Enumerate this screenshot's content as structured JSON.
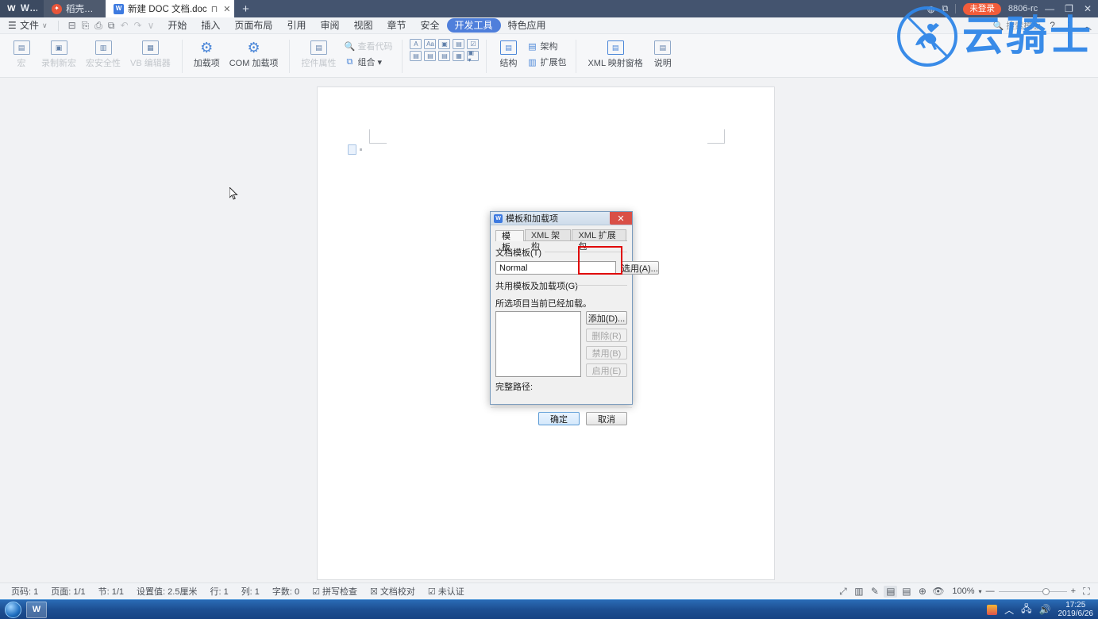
{
  "window": {
    "tabs": [
      {
        "label": "WPS",
        "icon": "wps-logo-icon"
      },
      {
        "label": "稻壳商城",
        "icon": "docer-mall-icon"
      },
      {
        "label": "新建 DOC 文档.doc",
        "icon": "doc-file-icon"
      }
    ],
    "new_tab_label": "+",
    "account_badge": "未登录",
    "build_label": "8806-rc",
    "minimize": "—",
    "restore": "❐",
    "close": "✕",
    "tab_restore_icon": "⊓",
    "tab_close_icon": "✕"
  },
  "menubar": {
    "file_label": "文件",
    "file_caret": "∨",
    "quick_access": [
      {
        "name": "save-icon",
        "glyph": "⊟"
      },
      {
        "name": "save-as-icon",
        "glyph": "⎘"
      },
      {
        "name": "print-icon",
        "glyph": "⎙"
      },
      {
        "name": "print-preview-icon",
        "glyph": "⧉"
      },
      {
        "name": "undo-icon",
        "glyph": "↶"
      },
      {
        "name": "redo-icon",
        "glyph": "↷"
      },
      {
        "name": "customize-qat-icon",
        "glyph": "∨"
      }
    ],
    "items": [
      {
        "label": "开始",
        "active": false
      },
      {
        "label": "插入",
        "active": false
      },
      {
        "label": "页面布局",
        "active": false
      },
      {
        "label": "引用",
        "active": false
      },
      {
        "label": "审阅",
        "active": false
      },
      {
        "label": "视图",
        "active": false
      },
      {
        "label": "章节",
        "active": false
      },
      {
        "label": "安全",
        "active": false
      },
      {
        "label": "开发工具",
        "active": true
      },
      {
        "label": "特色应用",
        "active": false
      }
    ],
    "search_placeholder": "搜索模板",
    "help_icon": "?",
    "more_icon": "⋮",
    "collapse_icon": "︿"
  },
  "ribbon": {
    "group1": [
      {
        "label": "宏",
        "glyph": "▤",
        "disabled": true
      },
      {
        "label": "录制新宏",
        "glyph": "▣",
        "disabled": true
      },
      {
        "label": "宏安全性",
        "glyph": "▥",
        "disabled": true
      },
      {
        "label": "VB 编辑器",
        "glyph": "▦",
        "disabled": true
      }
    ],
    "group2": [
      {
        "label": "加载项",
        "glyph": "⚙",
        "disabled": false
      },
      {
        "label": "COM 加载项",
        "glyph": "⚙",
        "disabled": false
      }
    ],
    "group3_big": [
      {
        "label": "控件属性",
        "glyph": "▤",
        "disabled": true
      }
    ],
    "group3_small": [
      {
        "label": "查看代码",
        "glyph": "🔍",
        "disabled": true
      },
      {
        "label": "组合 ▾",
        "glyph": "⧉",
        "disabled": false
      }
    ],
    "controls_row1": [
      "A",
      "Aa",
      "▣",
      "▤",
      "☑"
    ],
    "controls_row2": [
      "▤",
      "▤",
      "▤",
      "▦",
      "▣ ▾"
    ],
    "group5": [
      {
        "label": "结构",
        "glyph": "▤",
        "disabled": false
      }
    ],
    "group5_small": [
      {
        "label": "架构",
        "glyph": "▤",
        "disabled": false
      },
      {
        "label": "扩展包",
        "glyph": "▥",
        "disabled": false
      }
    ],
    "group6": [
      {
        "label": "XML 映射窗格",
        "glyph": "▤",
        "disabled": false
      },
      {
        "label": "说明",
        "glyph": "▤",
        "disabled": false
      }
    ]
  },
  "dialog": {
    "title": "模板和加载项",
    "close_glyph": "✕",
    "tabs": [
      {
        "label": "模板",
        "active": true
      },
      {
        "label": "XML 架构",
        "active": false
      },
      {
        "label": "XML 扩展包",
        "active": false
      }
    ],
    "doc_template_label": "文档模板(T)",
    "doc_template_value": "Normal",
    "attach_button": "选用(A)...",
    "shared_label": "共用模板及加载项(G)",
    "list_note": "所选项目当前已经加载。",
    "list_items": [],
    "add_button": "添加(D)...",
    "remove_button": "删除(R)",
    "disable_button": "禁用(B)",
    "enable_button": "启用(E)",
    "full_path_label": "完整路径:",
    "full_path_value": "",
    "ok_button": "确定",
    "cancel_button": "取消"
  },
  "statusbar": {
    "left_items": [
      {
        "label": "页码: 1"
      },
      {
        "label": "页面: 1/1"
      },
      {
        "label": "节: 1/1"
      },
      {
        "label": "设置值: 2.5厘米"
      },
      {
        "label": "行: 1"
      },
      {
        "label": "列: 1"
      },
      {
        "label": "字数: 0"
      },
      {
        "label": "拼写检查",
        "icon": "spellcheck-icon"
      },
      {
        "label": "文档校对",
        "icon": "proofread-icon"
      },
      {
        "label": "未认证",
        "icon": "uncertified-icon"
      }
    ],
    "view_icons": [
      {
        "name": "fullscreen-icon",
        "glyph": "⤢"
      },
      {
        "name": "two-page-icon",
        "glyph": "▥"
      },
      {
        "name": "pen-icon",
        "glyph": "✎"
      },
      {
        "name": "page-view-icon",
        "glyph": "▤"
      },
      {
        "name": "outline-view-icon",
        "glyph": "▤"
      },
      {
        "name": "web-view-icon",
        "glyph": "⊕"
      },
      {
        "name": "eye-protect-icon",
        "glyph": "👁"
      }
    ],
    "zoom_label": "100%",
    "zoom_caret": "▾",
    "zoom_out": "—",
    "zoom_in": "+",
    "fit_icon": "⛶"
  },
  "watermark": {
    "text": "云骑士"
  },
  "taskbar": {
    "apps": [
      {
        "name": "wps-taskbar-icon",
        "label": "W"
      }
    ],
    "tray_expand": "︿",
    "tray_icons": [
      {
        "name": "network-icon",
        "glyph": "🖧"
      },
      {
        "name": "volume-icon",
        "glyph": "🔊"
      }
    ],
    "time": "17:25",
    "date": "2019/6/26"
  }
}
